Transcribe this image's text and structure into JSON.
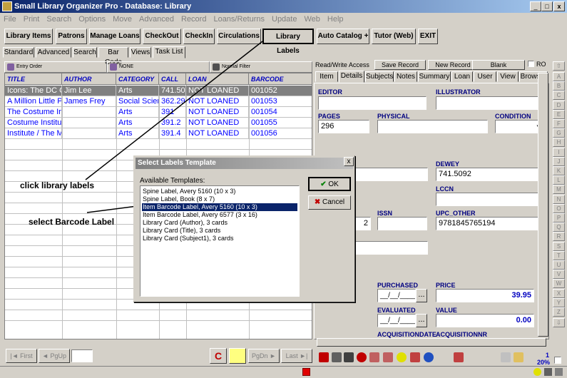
{
  "window": {
    "title": "Small Library Organizer Pro - Database: Library",
    "min": "_",
    "max": "□",
    "close": "x"
  },
  "menu": [
    "File",
    "Print",
    "Search",
    "Options",
    "Move",
    "Advanced",
    "Record",
    "Loans/Returns",
    "Update",
    "Web",
    "Help"
  ],
  "toolbar": {
    "library_items": "Library Items",
    "patrons": "Patrons",
    "manage_loans": "Manage Loans",
    "checkout": "CheckOut",
    "checkin": "CheckIn",
    "circulations": "Circulations",
    "library_labels": "Library Labels",
    "auto_catalog": "Auto Catalog +",
    "tutor": "Tutor (Web)",
    "exit": "EXIT"
  },
  "search_tabs": [
    "Standard",
    "Advanced",
    "Search",
    "Bar Code",
    "Views",
    "Task List"
  ],
  "filters": {
    "order": "Entry Order",
    "none": "NONE",
    "normal": "Normal Filter"
  },
  "grid": {
    "headers": [
      "TITLE",
      "AUTHOR",
      "CATEGORY",
      "CALL",
      "LOAN",
      "BARCODE"
    ],
    "rows": [
      [
        "Icons: The DC Co",
        "Jim Lee",
        "Arts",
        "741.509",
        "NOT LOANED",
        "001052"
      ],
      [
        "A Million Little Pi",
        "James Frey",
        "Social Scien",
        "362.290",
        "NOT LOANED",
        "001053"
      ],
      [
        "The Costume Ins",
        "",
        "Arts",
        "391",
        "NOT LOANED",
        "001054"
      ],
      [
        "Costume Institute",
        "",
        "Arts",
        "391.2",
        "NOT LOANED",
        "001055"
      ],
      [
        "Institute / The Me",
        "",
        "Arts",
        "391.4",
        "NOT LOANED",
        "001056"
      ]
    ]
  },
  "record": {
    "mode": "Read/Write Access",
    "save": "Save Record",
    "new": "New Record",
    "blank": "Blank",
    "ro": "RO",
    "tabs": [
      "Item",
      "Details",
      "Subjects",
      "Notes",
      "Summary",
      "Loan",
      "User",
      "View",
      "Browser"
    ],
    "labels": {
      "editor": "EDITOR",
      "illustrator": "ILLUSTRATOR",
      "pages": "PAGES",
      "physical": "PHYSICAL",
      "condition": "CONDITION",
      "dewey": "DEWEY",
      "lccn": "LCCN",
      "issn": "ISSN",
      "upc_other": "UPC_OTHER",
      "purchased": "PURCHASED",
      "price": "PRICE",
      "evaluated": "EVALUATED",
      "value": "VALUE",
      "acq_date": "ACQUISITIONDATE",
      "acq_nr": "ACQUISITIONNR"
    },
    "values": {
      "pages": "296",
      "dewey": "741.5092",
      "upc_other": "9781845765194",
      "partial_left": "2",
      "purchased": "__/__/____",
      "price": "39.95",
      "evaluated": "__/__/____",
      "value": "0.00",
      "dots": "..."
    }
  },
  "alphabet": [
    "A",
    "B",
    "C",
    "D",
    "E",
    "F",
    "G",
    "H",
    "I",
    "J",
    "K",
    "L",
    "M",
    "N",
    "O",
    "P",
    "Q",
    "R",
    "S",
    "T",
    "U",
    "V",
    "W",
    "X",
    "Y",
    "Z"
  ],
  "dialog": {
    "title": "Select Labels Template",
    "close": "x",
    "list_label": "Available Templates:",
    "templates": [
      "Spine Label, Avery 5160 (10 x 3)",
      "Spine Label, Book (8 x 7)",
      "Item Barcode Label, Avery 5160 (10 x 3)",
      "Item Barcode Label, Avery 6577 (3 x 16)",
      "Library Card (Author), 3 cards",
      "Library Card (Title), 3 cards",
      "Library Card (Subject1), 3 cards"
    ],
    "selected_index": 2,
    "ok": "OK",
    "cancel": "Cancel"
  },
  "annotations": {
    "click": "click library labels",
    "select": "select Barcode Label"
  },
  "nav": {
    "first": "First",
    "pgup": "PgUp",
    "pgdn": "PgDn",
    "last": "Last"
  },
  "zoom": {
    "page": "1",
    "level": "20%"
  },
  "colors": {
    "accent": "#0a246a",
    "link": "#0000ff"
  }
}
